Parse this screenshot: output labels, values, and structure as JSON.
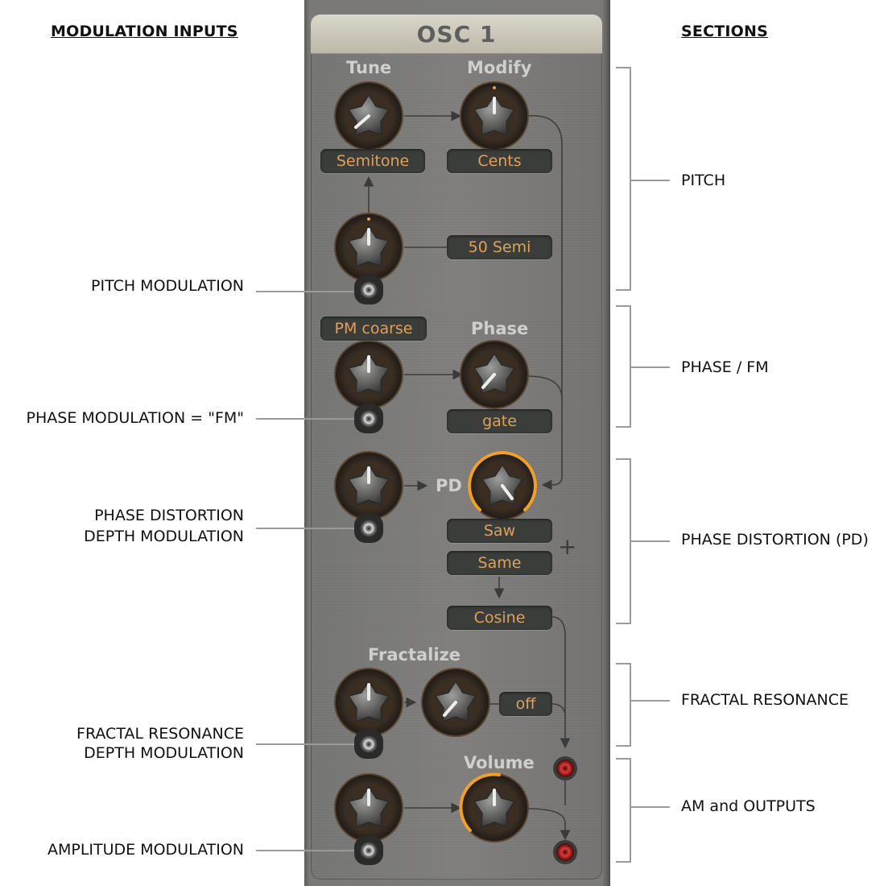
{
  "headings": {
    "modulation_inputs": "MODULATION INPUTS",
    "sections": "SECTIONS"
  },
  "panel": {
    "title": "OSC 1",
    "labels": {
      "tune": "Tune",
      "modify": "Modify",
      "phase": "Phase",
      "pd": "PD",
      "fractalize": "Fractalize",
      "volume": "Volume"
    },
    "values": {
      "semitone": "Semitone",
      "cents": "Cents",
      "semi50": "50 Semi",
      "pm_coarse": "PM coarse",
      "gate": "gate",
      "saw": "Saw",
      "same": "Same",
      "cosine": "Cosine",
      "off": "off"
    },
    "plus": "+"
  },
  "modulation_inputs": {
    "pitch": "PITCH MODULATION",
    "phase": "PHASE MODULATION = \"FM\"",
    "pd_line1": "PHASE DISTORTION",
    "pd_line2": "DEPTH MODULATION",
    "fractal_line1": "FRACTAL RESONANCE",
    "fractal_line2": "DEPTH MODULATION",
    "amplitude": "AMPLITUDE MODULATION"
  },
  "sections": {
    "pitch": "PITCH",
    "phase_fm": "PHASE / FM",
    "phase_distortion": "PHASE DISTORTION (PD)",
    "fractal_resonance": "FRACTAL RESONANCE",
    "am_outputs": "AM and OUTPUTS"
  },
  "colors": {
    "value_text": "#e0a05a",
    "active_ring": "#f0a028",
    "output_jack": "#c8262a"
  }
}
